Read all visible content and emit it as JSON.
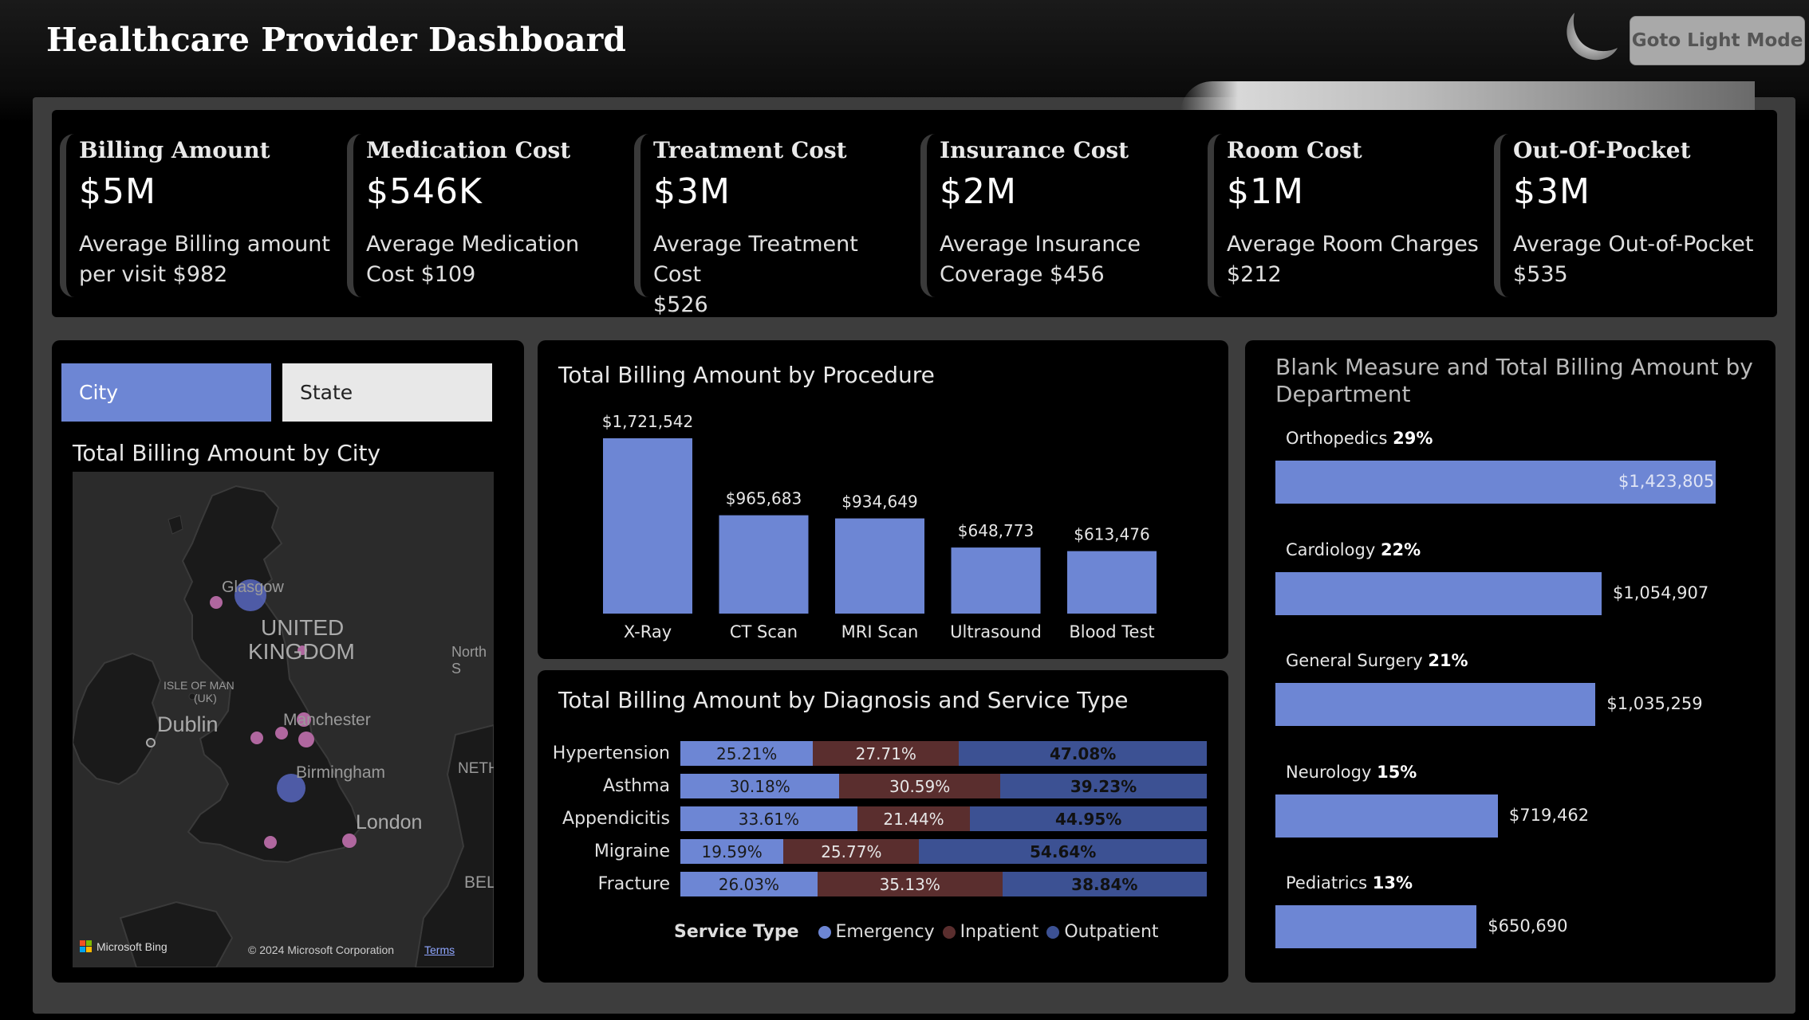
{
  "header": {
    "title": "Healthcare Provider Dashboard",
    "mode_button": "Goto Light Mode"
  },
  "kpis": [
    {
      "label": "Billing Amount",
      "value": "$5M",
      "desc1": "Average Billing amount",
      "desc2": "per visit $982"
    },
    {
      "label": "Medication Cost",
      "value": "$546K",
      "desc1": "Average Medication",
      "desc2": "Cost $109"
    },
    {
      "label": "Treatment Cost",
      "value": "$3M",
      "desc1": "Average Treatment Cost",
      "desc2": "$526"
    },
    {
      "label": "Insurance Cost",
      "value": "$2M",
      "desc1": "Average Insurance",
      "desc2": "Coverage $456"
    },
    {
      "label": "Room Cost",
      "value": "$1M",
      "desc1": "Average Room Charges",
      "desc2": "$212"
    },
    {
      "label": "Out-Of-Pocket",
      "value": "$3M",
      "desc1": "Average Out-of-Pocket",
      "desc2": "$535"
    }
  ],
  "map_card": {
    "toggle_city": "City",
    "toggle_state": "State",
    "title": "Total Billing Amount by City",
    "labels": {
      "glasgow": "Glasgow",
      "uk1": "UNITED",
      "uk2": "KINGDOM",
      "north": "North S",
      "isle1": "ISLE OF MAN",
      "isle2": "(UK)",
      "dublin": "Dublin",
      "manchester": "Manchester",
      "birmingham": "Birmingham",
      "neth": "NETH",
      "london": "London",
      "bel": "BEL"
    },
    "bing": "Microsoft Bing",
    "copyright": "© 2024 Microsoft Corporation",
    "terms": "Terms"
  },
  "chart_data": [
    {
      "type": "bar",
      "title": "Total Billing Amount by Procedure",
      "categories": [
        "X-Ray",
        "CT Scan",
        "MRI Scan",
        "Ultrasound",
        "Blood Test"
      ],
      "values": [
        1721542,
        965683,
        934649,
        648773,
        613476
      ],
      "value_labels": [
        "$1,721,542",
        "$965,683",
        "$934,649",
        "$648,773",
        "$613,476"
      ],
      "ylim": [
        0,
        1721542
      ],
      "color": "#6d86d4"
    },
    {
      "type": "bar",
      "stacked": "100%",
      "orientation": "horizontal",
      "title": "Total Billing Amount by Diagnosis and Service Type",
      "categories": [
        "Hypertension",
        "Asthma",
        "Appendicitis",
        "Migraine",
        "Fracture"
      ],
      "legend_title": "Service Type",
      "series": [
        {
          "name": "Emergency",
          "color": "#6d86d4",
          "values": [
            25.21,
            30.18,
            33.61,
            19.59,
            26.03
          ],
          "labels": [
            "25.21%",
            "30.18%",
            "33.61%",
            "19.59%",
            "26.03%"
          ]
        },
        {
          "name": "Inpatient",
          "color": "#5a2e2e",
          "values": [
            27.71,
            30.59,
            21.44,
            25.77,
            35.13
          ],
          "labels": [
            "27.71%",
            "30.59%",
            "21.44%",
            "25.77%",
            "35.13%"
          ]
        },
        {
          "name": "Outpatient",
          "color": "#3c5193",
          "values": [
            47.08,
            39.23,
            44.95,
            54.64,
            38.84
          ],
          "labels": [
            "47.08%",
            "39.23%",
            "44.95%",
            "54.64%",
            "38.84%"
          ]
        }
      ]
    },
    {
      "type": "bar",
      "orientation": "horizontal",
      "title": "Blank Measure and Total Billing Amount by Department",
      "title_line1": "Blank Measure and Total Billing Amount by",
      "title_line2": "Department",
      "categories": [
        "Orthopedics",
        "Cardiology",
        "General Surgery",
        "Neurology",
        "Pediatrics"
      ],
      "shares": [
        "29%",
        "22%",
        "21%",
        "15%",
        "13%"
      ],
      "values": [
        1423805,
        1054907,
        1035259,
        719462,
        650690
      ],
      "value_labels": [
        "$1,423,805",
        "$1,054,907",
        "$1,035,259",
        "$719,462",
        "$650,690"
      ],
      "xlim": [
        0,
        1423805
      ],
      "color": "#6d86d4"
    }
  ]
}
